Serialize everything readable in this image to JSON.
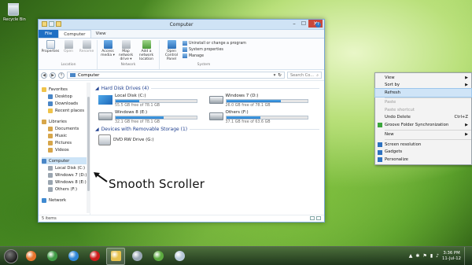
{
  "desktop": {
    "recycle_bin_label": "Recycle Bin"
  },
  "window": {
    "title": "Computer",
    "controls": {
      "minimize": "–",
      "maximize": "☐",
      "close": "✕"
    },
    "ribbon_tabs": [
      "File",
      "Computer",
      "View"
    ],
    "active_tab": "Computer",
    "ribbon": {
      "location": {
        "label": "Location",
        "buttons": [
          "Properties",
          "Open",
          "Rename"
        ]
      },
      "network": {
        "label": "Network",
        "buttons": [
          "Access media ▾",
          "Map network drive ▾",
          "Add a network location"
        ]
      },
      "system": {
        "label": "System",
        "open_cp": "Open Control Panel",
        "small": [
          "Uninstall or change a program",
          "System properties",
          "Manage"
        ]
      },
      "help": "?"
    },
    "address": {
      "path": "Computer",
      "search_placeholder": "Search Co...",
      "back": "◀",
      "forward": "▶",
      "up": "↑",
      "refresh": "↻",
      "dropdown": "▾",
      "search_icon": "⌕"
    },
    "nav_pane": {
      "favorites": "Favorites",
      "favorite_items": [
        "Desktop",
        "Downloads",
        "Recent places"
      ],
      "libraries": "Libraries",
      "library_items": [
        "Documents",
        "Music",
        "Pictures",
        "Videos"
      ],
      "computer": "Computer",
      "computer_items": [
        "Local Disk (C:)",
        "Windows 7 (D:)",
        "Windows 8 (E:)",
        "Others (F:)"
      ],
      "network": "Network"
    },
    "groups": {
      "hdd": "Hard Disk Drives (4)",
      "removable": "Devices with Removable Storage (1)"
    },
    "drives": [
      {
        "name": "Local Disk (C:)",
        "free": "55.5 GB free of 78.1 GB",
        "used_fraction": 0.29,
        "icon": "windows-drive-icon"
      },
      {
        "name": "Windows 7 (D:)",
        "free": "26.0 GB free of 78.1 GB",
        "used_fraction": 0.67,
        "icon": "hard-drive-icon"
      },
      {
        "name": "Windows 8 (E:)",
        "free": "32.1 GB free of 78.1 GB",
        "used_fraction": 0.59,
        "icon": "hard-drive-icon"
      },
      {
        "name": "Others (F:)",
        "free": "37.1 GB free of 63.6 GB",
        "used_fraction": 0.42,
        "icon": "hard-drive-icon"
      }
    ],
    "dvd": {
      "name": "DVD RW Drive (G:)"
    },
    "status": {
      "items": "5 items"
    }
  },
  "annotation": {
    "text": "Smooth Scroller"
  },
  "context_menu": {
    "items": [
      {
        "label": "View",
        "arrow": "▶",
        "disabled": false
      },
      {
        "label": "Sort by",
        "arrow": "▶",
        "disabled": false
      },
      {
        "label": "Refresh",
        "highlight": true
      },
      {
        "sep": true
      },
      {
        "label": "Paste",
        "disabled": true
      },
      {
        "label": "Paste shortcut",
        "disabled": true
      },
      {
        "label": "Undo Delete",
        "shortcut": "Ctrl+Z"
      },
      {
        "label": "Groove Folder Synchronization",
        "arrow": "▶",
        "icon": "groove-icon"
      },
      {
        "sep": true
      },
      {
        "label": "New",
        "arrow": "▶"
      },
      {
        "sep": true
      },
      {
        "label": "Screen resolution",
        "icon": "screen-icon"
      },
      {
        "label": "Gadgets",
        "icon": "gadgets-icon"
      },
      {
        "label": "Personalize",
        "icon": "personalize-icon"
      }
    ]
  },
  "taskbar": {
    "apps": [
      {
        "name": "firefox",
        "color": "#e8742c"
      },
      {
        "name": "chrome",
        "color": "#3f9a45"
      },
      {
        "name": "internet-explorer",
        "color": "#2f86d6"
      },
      {
        "name": "opera",
        "color": "#cc1b1b"
      },
      {
        "name": "explorer",
        "color": "#e6c24e",
        "active": true
      },
      {
        "name": "app-6",
        "color": "#9aa7b4"
      },
      {
        "name": "app-7",
        "color": "#5caa3f"
      },
      {
        "name": "app-8",
        "color": "#b7c9d8"
      }
    ],
    "time": "3:36 PM",
    "date": "11-Jul-12"
  }
}
